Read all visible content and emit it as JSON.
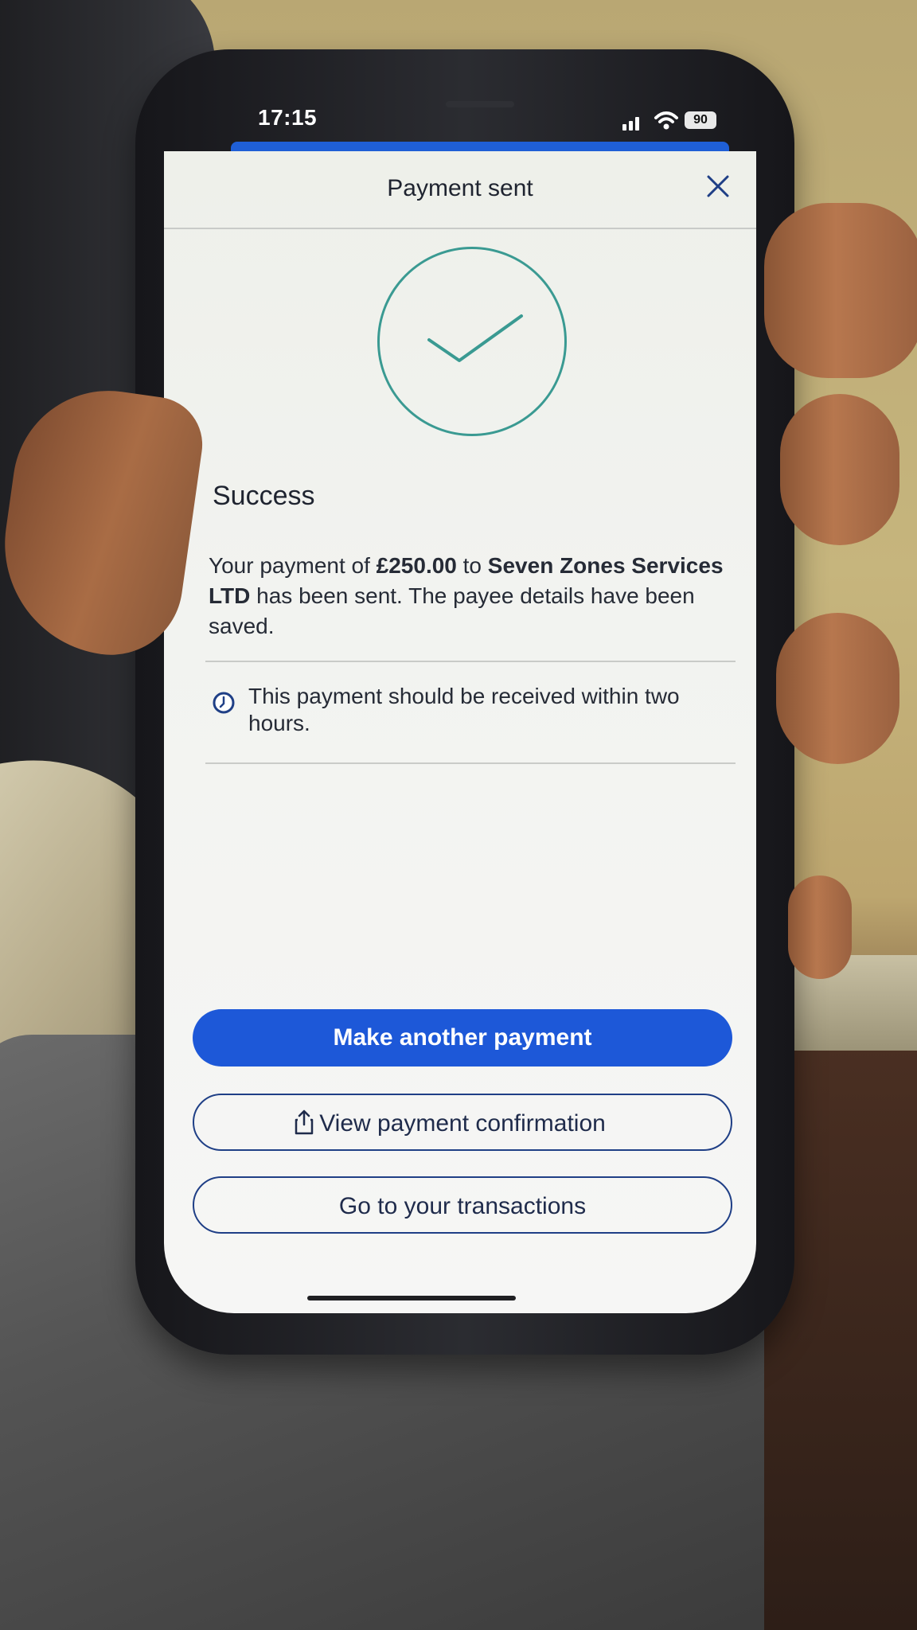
{
  "status_bar": {
    "time": "17:15",
    "battery": "90"
  },
  "screen": {
    "title": "Payment sent",
    "success_heading": "Success",
    "message_prefix": "Your payment of ",
    "amount": "£250.00",
    "message_middle": " to ",
    "payee": "Seven Zones Services LTD",
    "message_suffix": " has been sent. The payee details have been saved.",
    "info_text": "This payment should be received within two hours."
  },
  "buttons": {
    "make_another": "Make another payment",
    "view_confirmation": "View payment confirmation",
    "go_transactions": "Go to your transactions"
  },
  "icons": {
    "close": "close-icon",
    "check": "check-icon",
    "clock": "clock-icon",
    "share": "share-icon",
    "signal": "signal-icon",
    "wifi": "wifi-icon",
    "battery": "battery-icon"
  },
  "colors": {
    "primary": "#1d58d8",
    "success": "#3a9a92",
    "text": "#262b36"
  }
}
